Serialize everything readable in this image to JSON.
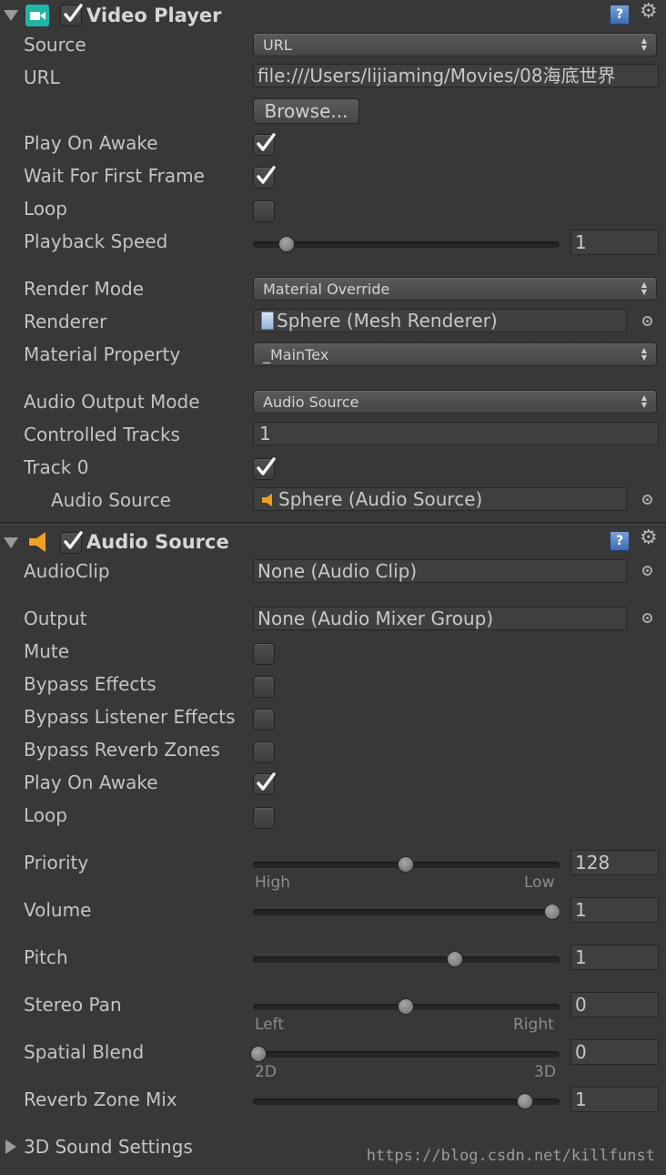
{
  "video_player": {
    "title": "Video Player",
    "source": {
      "label": "Source",
      "value": "URL"
    },
    "url": {
      "label": "URL",
      "value": "file:///Users/lijiaming/Movies/08海底世界"
    },
    "browse_label": "Browse...",
    "play_on_awake": {
      "label": "Play On Awake",
      "checked": true
    },
    "wait_first_frame": {
      "label": "Wait For First Frame",
      "checked": true
    },
    "loop": {
      "label": "Loop",
      "checked": false
    },
    "playback_speed": {
      "label": "Playback Speed",
      "value": "1"
    },
    "render_mode": {
      "label": "Render Mode",
      "value": "Material Override"
    },
    "renderer": {
      "label": "Renderer",
      "value": "Sphere (Mesh Renderer)"
    },
    "material_property": {
      "label": "Material Property",
      "value": "_MainTex"
    },
    "audio_output_mode": {
      "label": "Audio Output Mode",
      "value": "Audio Source"
    },
    "controlled_tracks": {
      "label": "Controlled Tracks",
      "value": "1"
    },
    "track0": {
      "label": "Track 0",
      "checked": true
    },
    "audio_source": {
      "label": "Audio Source",
      "value": "Sphere (Audio Source)"
    }
  },
  "audio_source": {
    "title": "Audio Source",
    "audioclip": {
      "label": "AudioClip",
      "value": "None (Audio Clip)"
    },
    "output": {
      "label": "Output",
      "value": "None (Audio Mixer Group)"
    },
    "mute": {
      "label": "Mute",
      "checked": false
    },
    "bypass_effects": {
      "label": "Bypass Effects",
      "checked": false
    },
    "bypass_listener": {
      "label": "Bypass Listener Effects",
      "checked": false
    },
    "bypass_reverb": {
      "label": "Bypass Reverb Zones",
      "checked": false
    },
    "play_on_awake": {
      "label": "Play On Awake",
      "checked": true
    },
    "loop": {
      "label": "Loop",
      "checked": false
    },
    "priority": {
      "label": "Priority",
      "value": "128",
      "min_label": "High",
      "max_label": "Low"
    },
    "volume": {
      "label": "Volume",
      "value": "1"
    },
    "pitch": {
      "label": "Pitch",
      "value": "1"
    },
    "stereo_pan": {
      "label": "Stereo Pan",
      "value": "0",
      "min_label": "Left",
      "max_label": "Right"
    },
    "spatial_blend": {
      "label": "Spatial Blend",
      "value": "0",
      "min_label": "2D",
      "max_label": "3D"
    },
    "reverb_zone_mix": {
      "label": "Reverb Zone Mix",
      "value": "1"
    },
    "sound_settings": {
      "label": "3D Sound Settings"
    }
  },
  "watermark": "https://blog.csdn.net/killfunst",
  "colors": {
    "video_icon": "#1fb5a6",
    "audio_icon": "#f0a022",
    "background": "#383838"
  }
}
